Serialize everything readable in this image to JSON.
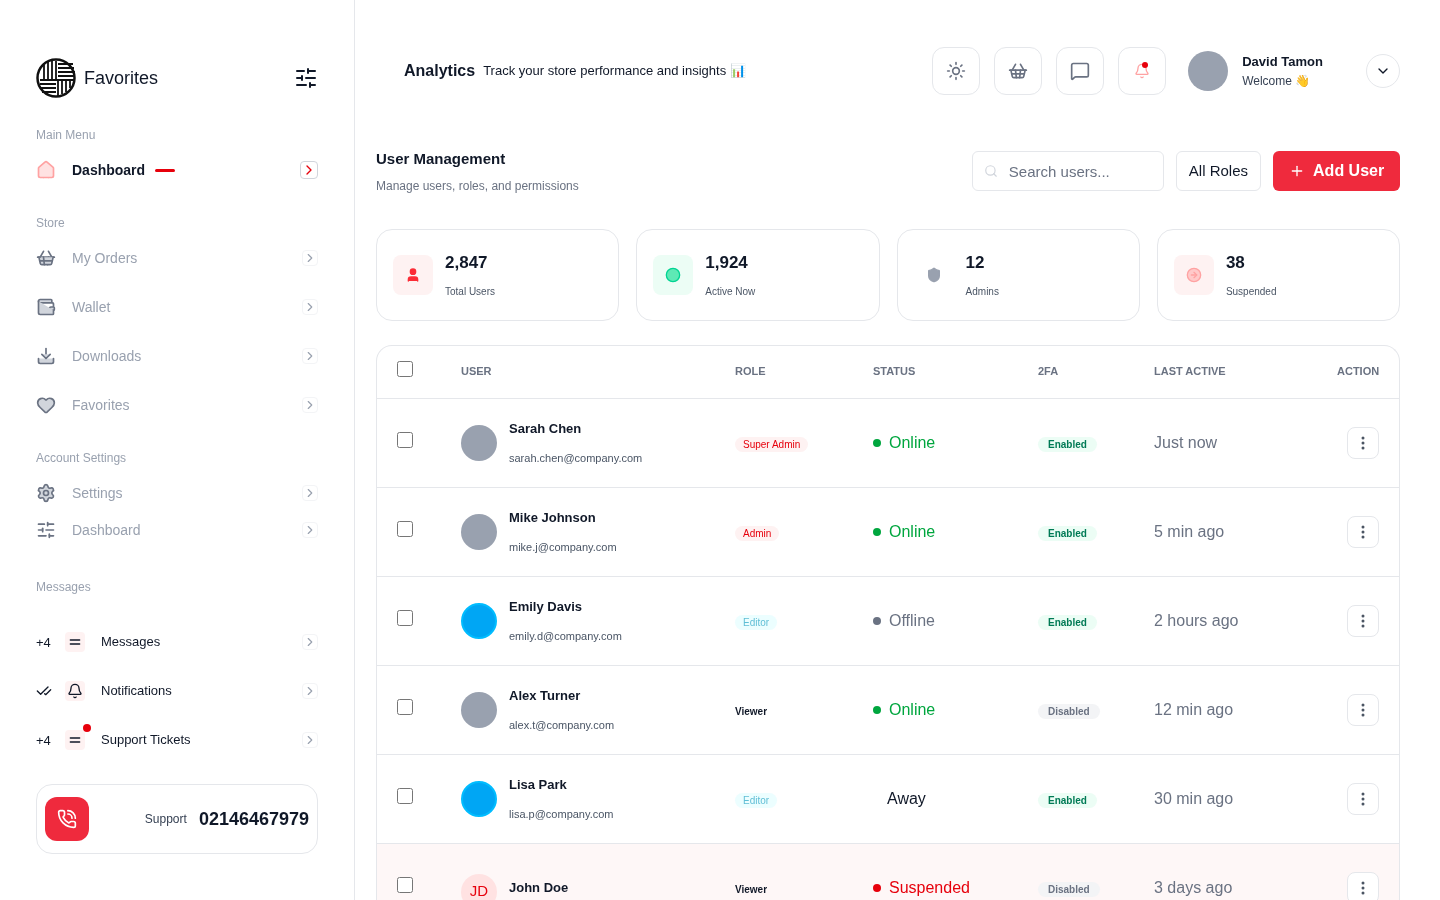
{
  "sidebar": {
    "brand": "Favorites",
    "sections": [
      {
        "title": "Main Menu",
        "items": [
          {
            "kind": "nav",
            "label": "Dashboard",
            "selected": true
          }
        ]
      },
      {
        "title": "Store",
        "items": [
          {
            "kind": "nav",
            "label": "My Orders",
            "selected": false
          },
          {
            "kind": "nav",
            "label": "Wallet",
            "selected": false
          },
          {
            "kind": "nav",
            "label": "Downloads",
            "selected": false
          },
          {
            "kind": "nav",
            "label": "Favorites",
            "selected": false
          }
        ]
      },
      {
        "title": "Account Settings",
        "items": [
          {
            "kind": "nav",
            "label": "Settings",
            "selected": false
          },
          {
            "kind": "nav",
            "label": "Dashboard",
            "selected": false
          }
        ]
      },
      {
        "title": "Messages",
        "items": [
          {
            "kind": "message",
            "prefix": "+4",
            "label": "Messages",
            "unread_dot": false
          },
          {
            "kind": "read",
            "label": "Notifications",
            "unread_dot": false
          },
          {
            "kind": "message",
            "prefix": "+4",
            "label": "Support Tickets",
            "unread_dot": true
          }
        ]
      }
    ],
    "support": {
      "label": "Support",
      "phone": "02146467979"
    }
  },
  "header": {
    "title": "Analytics",
    "subtitle": "Track your store performance and insights 📊",
    "notification_dot": true,
    "user": {
      "name": "David Tamon",
      "greeting": "Welcome 👋"
    }
  },
  "page": {
    "title": "User Management",
    "subtitle": "Manage users, roles, and permissions",
    "search": {
      "placeholder": "Search users..."
    },
    "role_filter": "All Roles",
    "add_button": "Add User"
  },
  "stats": [
    {
      "kind": "users",
      "value": "2,847",
      "label": "Total Users"
    },
    {
      "kind": "active",
      "value": "1,924",
      "label": "Active Now"
    },
    {
      "kind": "admins",
      "value": "12",
      "label": "Admins"
    },
    {
      "kind": "suspended",
      "value": "38",
      "label": "Suspended"
    }
  ],
  "table": {
    "select_all_checked": false,
    "columns": [
      "USER",
      "ROLE",
      "STATUS",
      "2FA",
      "LAST ACTIVE",
      "ACTION"
    ],
    "rows": [
      {
        "checked": false,
        "avatar": {
          "kind": "photo"
        },
        "name": "Sarah Chen",
        "email": "sarah.chen@company.com",
        "role": {
          "kind": "super_admin",
          "label": "Super Admin"
        },
        "status": {
          "kind": "online",
          "label": "Online"
        },
        "twofa": "Enabled",
        "twofa_on": true,
        "last_active": "Just now"
      },
      {
        "checked": false,
        "avatar": {
          "kind": "photo"
        },
        "name": "Mike Johnson",
        "email": "mike.j@company.com",
        "role": {
          "kind": "admin",
          "label": "Admin"
        },
        "status": {
          "kind": "online",
          "label": "Online"
        },
        "twofa": "Enabled",
        "twofa_on": true,
        "last_active": "5 min ago"
      },
      {
        "checked": false,
        "avatar": {
          "kind": "illustration"
        },
        "name": "Emily Davis",
        "email": "emily.d@company.com",
        "role": {
          "kind": "editor",
          "label": "Editor"
        },
        "status": {
          "kind": "offline",
          "label": "Offline"
        },
        "twofa": "Enabled",
        "twofa_on": true,
        "last_active": "2 hours ago"
      },
      {
        "checked": false,
        "avatar": {
          "kind": "photo"
        },
        "name": "Alex Turner",
        "email": "alex.t@company.com",
        "role": {
          "kind": "viewer",
          "label": "Viewer"
        },
        "status": {
          "kind": "online",
          "label": "Online"
        },
        "twofa": "Disabled",
        "twofa_on": false,
        "last_active": "12 min ago"
      },
      {
        "checked": false,
        "avatar": {
          "kind": "illustration"
        },
        "name": "Lisa Park",
        "email": "lisa.p@company.com",
        "role": {
          "kind": "editor",
          "label": "Editor"
        },
        "status": {
          "kind": "away",
          "label": "Away"
        },
        "twofa": "Enabled",
        "twofa_on": true,
        "last_active": "30 min ago"
      },
      {
        "checked": false,
        "avatar": {
          "kind": "initials",
          "initials": "JD"
        },
        "name": "John Doe",
        "role": {
          "kind": "viewer",
          "label": "Viewer"
        },
        "status": {
          "kind": "suspended",
          "label": "Suspended"
        },
        "twofa": "Disabled",
        "twofa_on": false,
        "last_active": "3 days ago"
      }
    ]
  }
}
